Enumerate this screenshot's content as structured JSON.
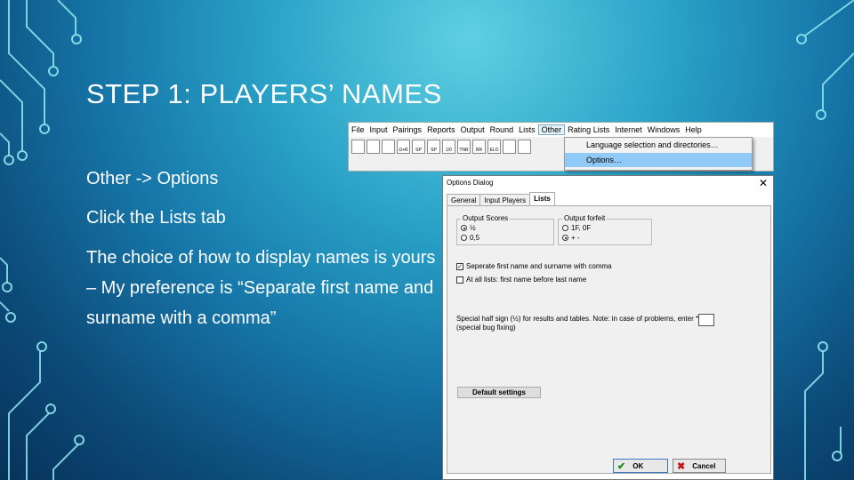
{
  "slide": {
    "title": "STEP 1: PLAYERS’ NAMES",
    "bullets": [
      "Other -> Options",
      "Click the Lists tab",
      "The choice of how to display names is yours – My preference is “Separate first name and surname with a comma”"
    ]
  },
  "menubar": {
    "items": [
      "File",
      "Input",
      "Pairings",
      "Reports",
      "Output",
      "Round",
      "Lists",
      "Other",
      "Rating Lists",
      "Internet",
      "Windows",
      "Help"
    ],
    "active_item": "Other",
    "toolbar_labels": [
      "",
      "",
      "",
      "Ω+R",
      "SP",
      "SP",
      "1/0",
      "TNR",
      "RR",
      "ELO"
    ],
    "dropdown": [
      "Language selection and directories…",
      "Options…"
    ],
    "dropdown_selected": "Options…"
  },
  "dialog": {
    "title": "Options Dialog",
    "close_glyph": "✕",
    "tabs": [
      "General",
      "Input Players",
      "Lists"
    ],
    "active_tab": "Lists",
    "output_scores": {
      "label": "Output Scores",
      "options": [
        "½",
        "0,5"
      ],
      "selected": "½"
    },
    "output_forfeit": {
      "label": "Output forfeit",
      "options": [
        "1F, 0F",
        "+ -"
      ],
      "selected": "+ -"
    },
    "checkboxes": [
      {
        "label": "Seperate first name and surname with comma",
        "checked": true
      },
      {
        "label": "At all lists: first name before last name",
        "checked": false
      }
    ],
    "half_sign_label": "Special half sign (½) for results and tables. Note: in case of problems, enter * (special bug fixing)",
    "default_button": "Default settings",
    "ok_button": "OK",
    "cancel_button": "Cancel"
  },
  "icons": [
    "check-icon",
    "close-icon"
  ],
  "colors": {
    "accent_circuit": "#8fe6f0",
    "menu_highlight": "#91c9f7"
  }
}
